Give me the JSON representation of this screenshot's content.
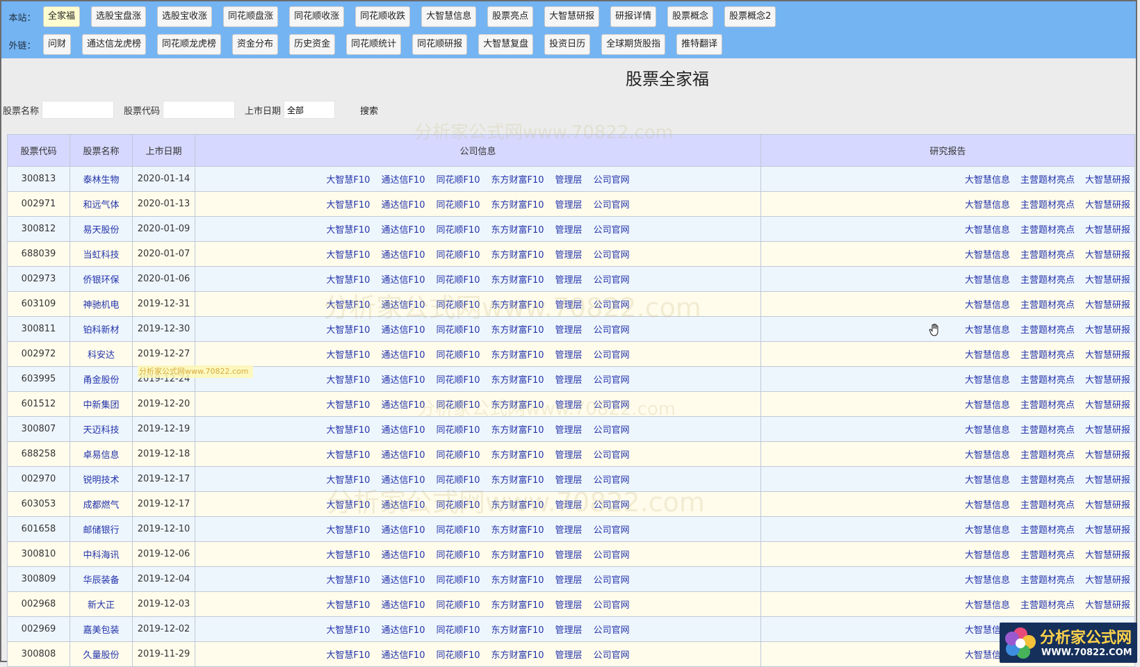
{
  "nav": {
    "site_label": "本站：",
    "site_items": [
      "全家福",
      "选股宝盘涨",
      "选股宝收涨",
      "同花顺盘涨",
      "同花顺收涨",
      "同花顺收跌",
      "大智慧信息",
      "股票亮点",
      "大智慧研报",
      "研报详情",
      "股票概念",
      "股票概念2"
    ],
    "external_label": "外链：",
    "external_items": [
      "问财",
      "通达信龙虎榜",
      "同花顺龙虎榜",
      "资金分布",
      "历史资金",
      "同花顺统计",
      "同花顺研报",
      "大智慧复盘",
      "投资日历",
      "全球期货股指",
      "推特翻译"
    ]
  },
  "page_title": "股票全家福",
  "search": {
    "name_label": "股票名称",
    "name_value": "",
    "code_label": "股票代码",
    "code_value": "",
    "date_label": "上市日期",
    "date_value": "全部",
    "button_label": "搜索"
  },
  "table": {
    "headers": {
      "code": "股票代码",
      "name": "股票名称",
      "date": "上市日期",
      "info": "公司信息",
      "report": "研究报告"
    },
    "info_links": [
      "大智慧F10",
      "通达信F10",
      "同花顺F10",
      "东方财富F10",
      "管理层",
      "公司官网"
    ],
    "report_links": [
      "大智慧信息",
      "主营题材亮点",
      "大智慧研报"
    ],
    "rows": [
      {
        "code": "300813",
        "name": "泰林生物",
        "date": "2020-01-14"
      },
      {
        "code": "002971",
        "name": "和远气体",
        "date": "2020-01-13"
      },
      {
        "code": "300812",
        "name": "易天股份",
        "date": "2020-01-09"
      },
      {
        "code": "688039",
        "name": "当虹科技",
        "date": "2020-01-07"
      },
      {
        "code": "002973",
        "name": "侨银环保",
        "date": "2020-01-06"
      },
      {
        "code": "603109",
        "name": "神驰机电",
        "date": "2019-12-31"
      },
      {
        "code": "300811",
        "name": "铂科新材",
        "date": "2019-12-30"
      },
      {
        "code": "002972",
        "name": "科安达",
        "date": "2019-12-27"
      },
      {
        "code": "603995",
        "name": "甬金股份",
        "date": "2019-12-24"
      },
      {
        "code": "601512",
        "name": "中新集团",
        "date": "2019-12-20"
      },
      {
        "code": "300807",
        "name": "天迈科技",
        "date": "2019-12-19"
      },
      {
        "code": "688258",
        "name": "卓易信息",
        "date": "2019-12-18"
      },
      {
        "code": "002970",
        "name": "锐明技术",
        "date": "2019-12-17"
      },
      {
        "code": "603053",
        "name": "成都燃气",
        "date": "2019-12-17"
      },
      {
        "code": "601658",
        "name": "邮储银行",
        "date": "2019-12-10"
      },
      {
        "code": "300810",
        "name": "中科海讯",
        "date": "2019-12-06"
      },
      {
        "code": "300809",
        "name": "华辰装备",
        "date": "2019-12-04"
      },
      {
        "code": "002968",
        "name": "新大正",
        "date": "2019-12-03"
      },
      {
        "code": "002969",
        "name": "嘉美包装",
        "date": "2019-12-02"
      },
      {
        "code": "300808",
        "name": "久量股份",
        "date": "2019-11-29"
      }
    ]
  },
  "watermarks": {
    "small": "分析家公式网www.70822.com",
    "large": [
      "分析家公式网www.70822.com",
      "分析家公式网www.70822.com",
      "分析家公式网www.70822.com",
      "分析家公式网www.70822.com"
    ]
  },
  "logo": {
    "title": "分析家公式网",
    "url": "WWW.70822.COM"
  },
  "colors": {
    "topbar": "#74b4f2",
    "header_bg": "#d6d8ff",
    "row_odd": "#eef6fd",
    "row_even": "#fffcec",
    "link": "#2233aa"
  }
}
